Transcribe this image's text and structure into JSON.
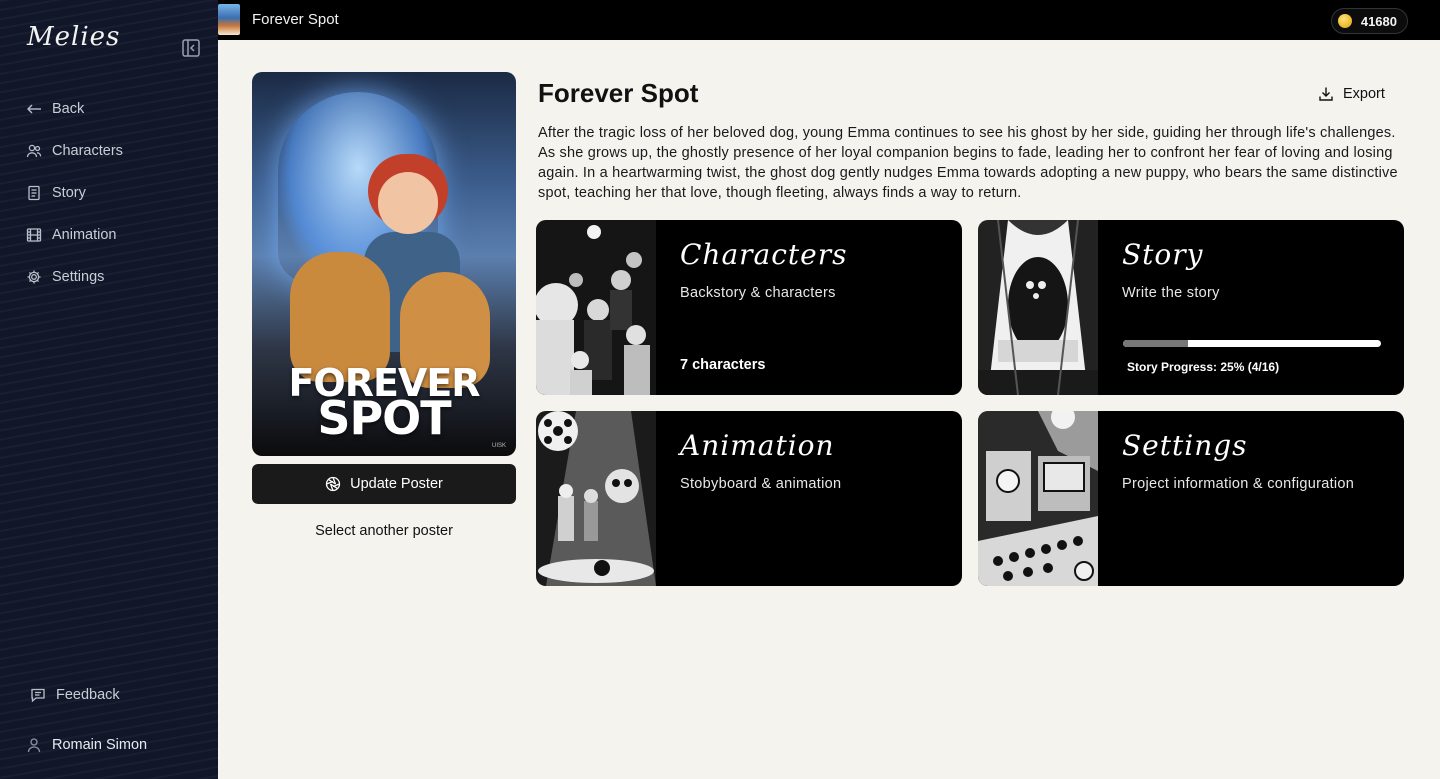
{
  "app": {
    "logo": "Melies",
    "colors": {
      "sidebar": "#111729",
      "topbar": "#000000",
      "canvas": "#f4f3ee",
      "card": "#000000",
      "coin": "#e0a400"
    }
  },
  "sidebar": {
    "collapse_icon": "sidebar-collapse-icon",
    "items": [
      {
        "label": "Back",
        "icon": "arrow-left-icon"
      },
      {
        "label": "Characters",
        "icon": "users-icon"
      },
      {
        "label": "Story",
        "icon": "document-icon"
      },
      {
        "label": "Animation",
        "icon": "film-icon"
      },
      {
        "label": "Settings",
        "icon": "gear-icon"
      }
    ],
    "feedback": {
      "label": "Feedback",
      "icon": "chat-icon"
    },
    "user": {
      "name": "Romain Simon",
      "icon": "user-icon"
    }
  },
  "topbar": {
    "title": "Forever Spot",
    "coins": "41680"
  },
  "poster": {
    "title_line1": "FOREVER",
    "title_line2": "SPOT",
    "mark": "UISK",
    "update_label": "Update Poster",
    "select_label": "Select another poster"
  },
  "project": {
    "title": "Forever Spot",
    "export_label": "Export",
    "description": "After the tragic loss of her beloved dog, young Emma continues to see his ghost by her side, guiding her through life's challenges. As she grows up, the ghostly presence of her loyal companion begins to fade, leading her to confront her fear of loving and losing again. In a heartwarming twist, the ghost dog gently nudges Emma towards adopting a new puppy, who bears the same distinctive spot, teaching her that love, though fleeting, always finds a way to return."
  },
  "cards": {
    "characters": {
      "title": "Characters",
      "subtitle": "Backstory & characters",
      "meta": "7 characters"
    },
    "story": {
      "title": "Story",
      "subtitle": "Write the story",
      "progress": 0.25,
      "progress_label": "Story Progress: 25% (4/16)"
    },
    "animation": {
      "title": "Animation",
      "subtitle": "Stobyboard & animation"
    },
    "settings": {
      "title": "Settings",
      "subtitle": "Project information & configuration"
    }
  }
}
